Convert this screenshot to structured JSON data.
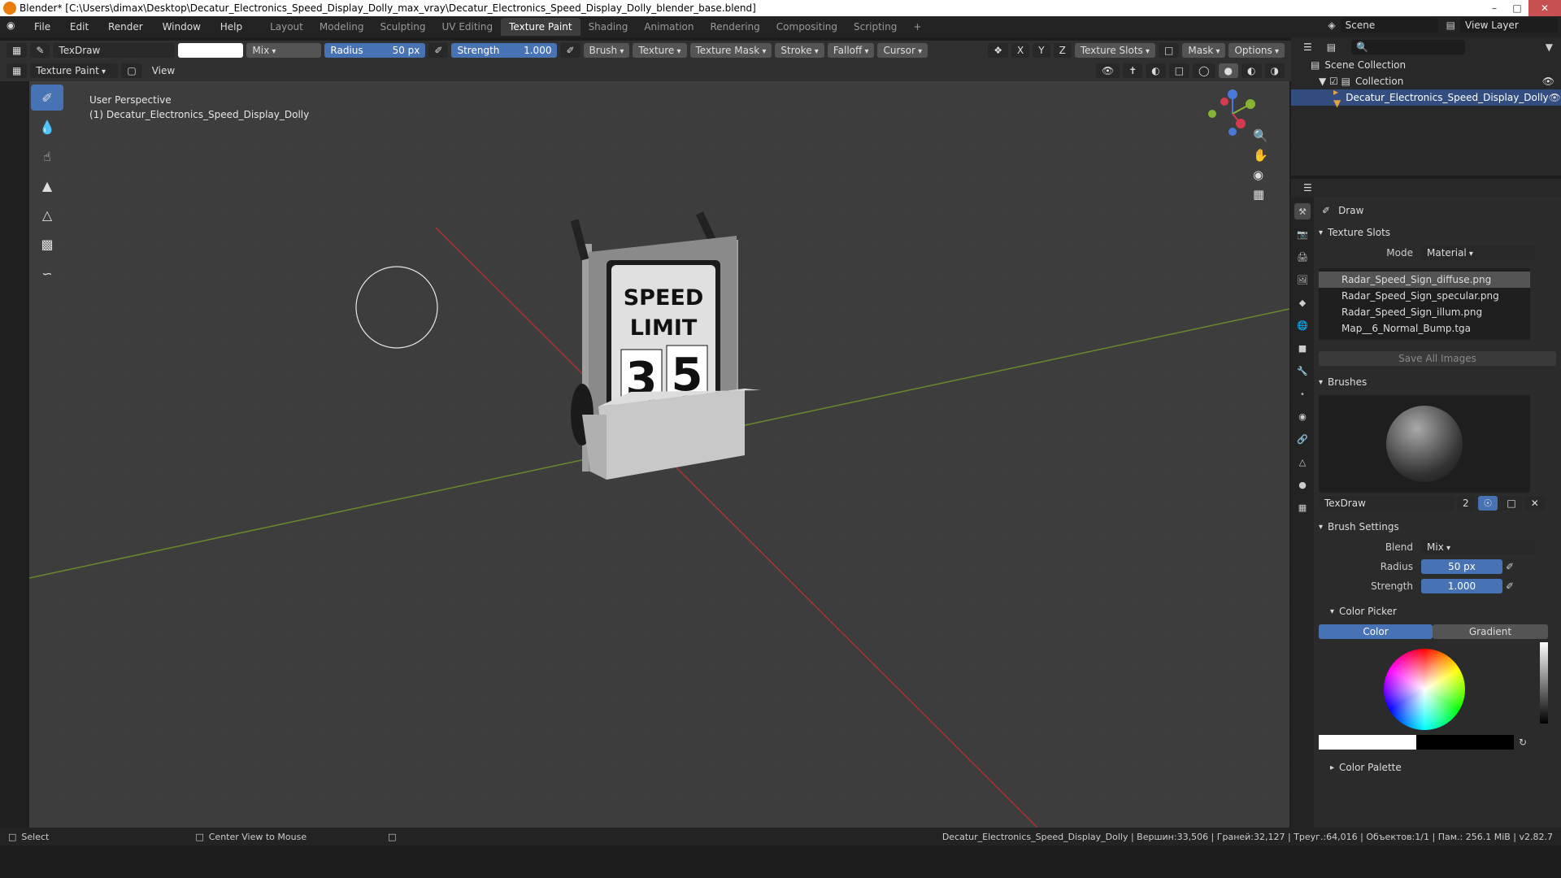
{
  "window": {
    "title": "Blender* [C:\\Users\\dimax\\Desktop\\Decatur_Electronics_Speed_Display_Dolly_max_vray\\Decatur_Electronics_Speed_Display_Dolly_blender_base.blend]"
  },
  "menu": [
    "File",
    "Edit",
    "Render",
    "Window",
    "Help"
  ],
  "workspaces": [
    "Layout",
    "Modeling",
    "Sculpting",
    "UV Editing",
    "Texture Paint",
    "Shading",
    "Animation",
    "Rendering",
    "Compositing",
    "Scripting"
  ],
  "topright": {
    "scene": "Scene",
    "view_layer": "View Layer"
  },
  "toolheader": {
    "brush": "TexDraw",
    "blend": "Mix",
    "radius_label": "Radius",
    "radius": "50 px",
    "strength_label": "Strength",
    "strength": "1.000",
    "menus": [
      "Brush",
      "Texture",
      "Texture Mask",
      "Stroke",
      "Falloff",
      "Cursor"
    ],
    "axes": [
      "X",
      "Y",
      "Z"
    ],
    "texture_slots": "Texture Slots",
    "mask": "Mask",
    "options": "Options"
  },
  "header2": {
    "mode": "Texture Paint",
    "view": "View"
  },
  "viewport": {
    "perspective": "User Perspective",
    "object": "(1) Decatur_Electronics_Speed_Display_Dolly",
    "sign_line1": "SPEED",
    "sign_line2": "LIMIT",
    "sign_digit1": "3",
    "sign_digit2": "5"
  },
  "outliner": {
    "scene_collection": "Scene Collection",
    "collection": "Collection",
    "object": "Decatur_Electronics_Speed_Display_Dolly"
  },
  "props": {
    "tool": "Draw",
    "texture_slots_title": "Texture Slots",
    "mode_label": "Mode",
    "mode": "Material",
    "slots": [
      "Radar_Speed_Sign_diffuse.png",
      "Radar_Speed_Sign_specular.png",
      "Radar_Speed_Sign_illum.png",
      "Map__6_Normal_Bump.tga"
    ],
    "save_all": "Save All Images",
    "brushes_title": "Brushes",
    "brush_name": "TexDraw",
    "brush_users": "2",
    "brush_settings_title": "Brush Settings",
    "blend_label": "Blend",
    "blend": "Mix",
    "radius_label": "Radius",
    "radius": "50 px",
    "strength_label": "Strength",
    "strength": "1.000",
    "color_picker_title": "Color Picker",
    "color_tab": "Color",
    "gradient_tab": "Gradient",
    "color_palette_title": "Color Palette"
  },
  "status": {
    "select": "Select",
    "center": "Center View to Mouse",
    "stats": "Decatur_Electronics_Speed_Display_Dolly | Вершин:33,506 | Граней:32,127 | Треуг.:64,016 | Объектов:1/1 | Пам.: 256.1 MiB | v2.82.7"
  }
}
